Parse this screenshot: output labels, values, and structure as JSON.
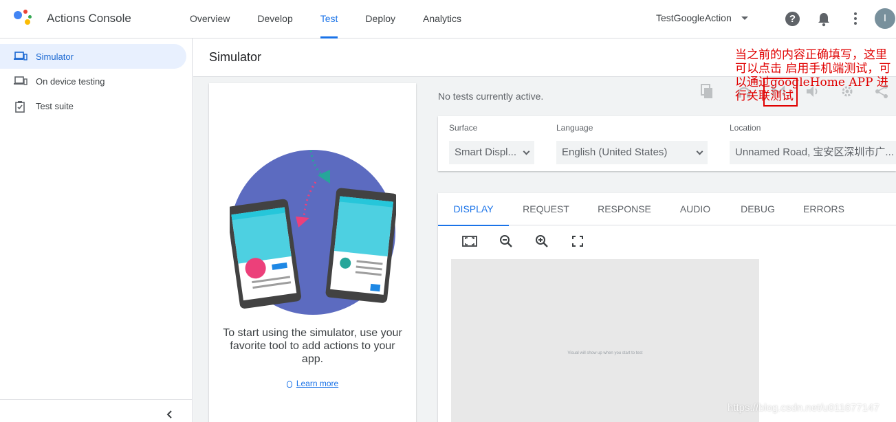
{
  "app": {
    "title": "Actions Console"
  },
  "nav": {
    "items": [
      {
        "label": "Overview"
      },
      {
        "label": "Develop"
      },
      {
        "label": "Test",
        "active": true
      },
      {
        "label": "Deploy"
      },
      {
        "label": "Analytics"
      }
    ]
  },
  "header": {
    "project_name": "TestGoogleAction",
    "avatar_initial": "I",
    "help_glyph": "?"
  },
  "sidebar": {
    "items": [
      {
        "label": "Simulator",
        "icon": "device-icon",
        "active": true
      },
      {
        "label": "On device testing",
        "icon": "device-icon"
      },
      {
        "label": "Test suite",
        "icon": "clipboard-check-icon"
      }
    ]
  },
  "page": {
    "title": "Simulator"
  },
  "intro": {
    "text": "To start using the simulator, use your favorite tool to add actions to your app.",
    "learn_more": "Learn more"
  },
  "status": {
    "text": "No tests currently active."
  },
  "settings": {
    "surface": {
      "label": "Surface",
      "value": "Smart Displ..."
    },
    "language": {
      "label": "Language",
      "value": "English (United States)"
    },
    "location": {
      "label": "Location",
      "value": "Unnamed Road, 宝安区深圳市广..."
    }
  },
  "tabs": [
    {
      "label": "DISPLAY",
      "active": true
    },
    {
      "label": "REQUEST"
    },
    {
      "label": "RESPONSE"
    },
    {
      "label": "AUDIO"
    },
    {
      "label": "DEBUG"
    },
    {
      "label": "ERRORS"
    }
  ],
  "display": {
    "hint": "Visual will show up when you start to test"
  },
  "annotation": {
    "text": "当之前的内容正确填写，这里可以点击 启用手机端测试，可以通过googleHome APP 进行关联测试"
  },
  "watermark": "https://blog.csdn.net/u011677147",
  "colors": {
    "accent": "#1a73e8",
    "annotation": "#e00000",
    "sidebar_active_bg": "#e8f0fe"
  }
}
